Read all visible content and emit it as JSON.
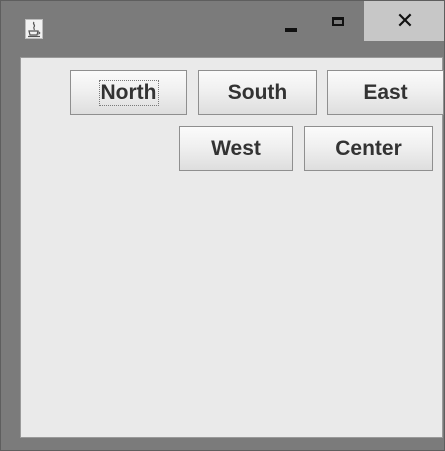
{
  "window": {
    "title": "",
    "close_symbol": "✕",
    "icons": {
      "app": "java-coffee-cup-icon",
      "minimize": "minimize-icon",
      "maximize": "maximize-icon",
      "close": "close-icon"
    }
  },
  "buttons": [
    {
      "id": "north",
      "label": "North",
      "focused": true
    },
    {
      "id": "south",
      "label": "South",
      "focused": false
    },
    {
      "id": "east",
      "label": "East",
      "focused": false
    },
    {
      "id": "west",
      "label": "West",
      "focused": false
    },
    {
      "id": "center",
      "label": "Center",
      "focused": false
    }
  ],
  "colors": {
    "titlebar": "#7b7b7b",
    "close_hover": "#c7c7c7",
    "content_bg": "#eaeaea",
    "button_text": "#333333"
  }
}
